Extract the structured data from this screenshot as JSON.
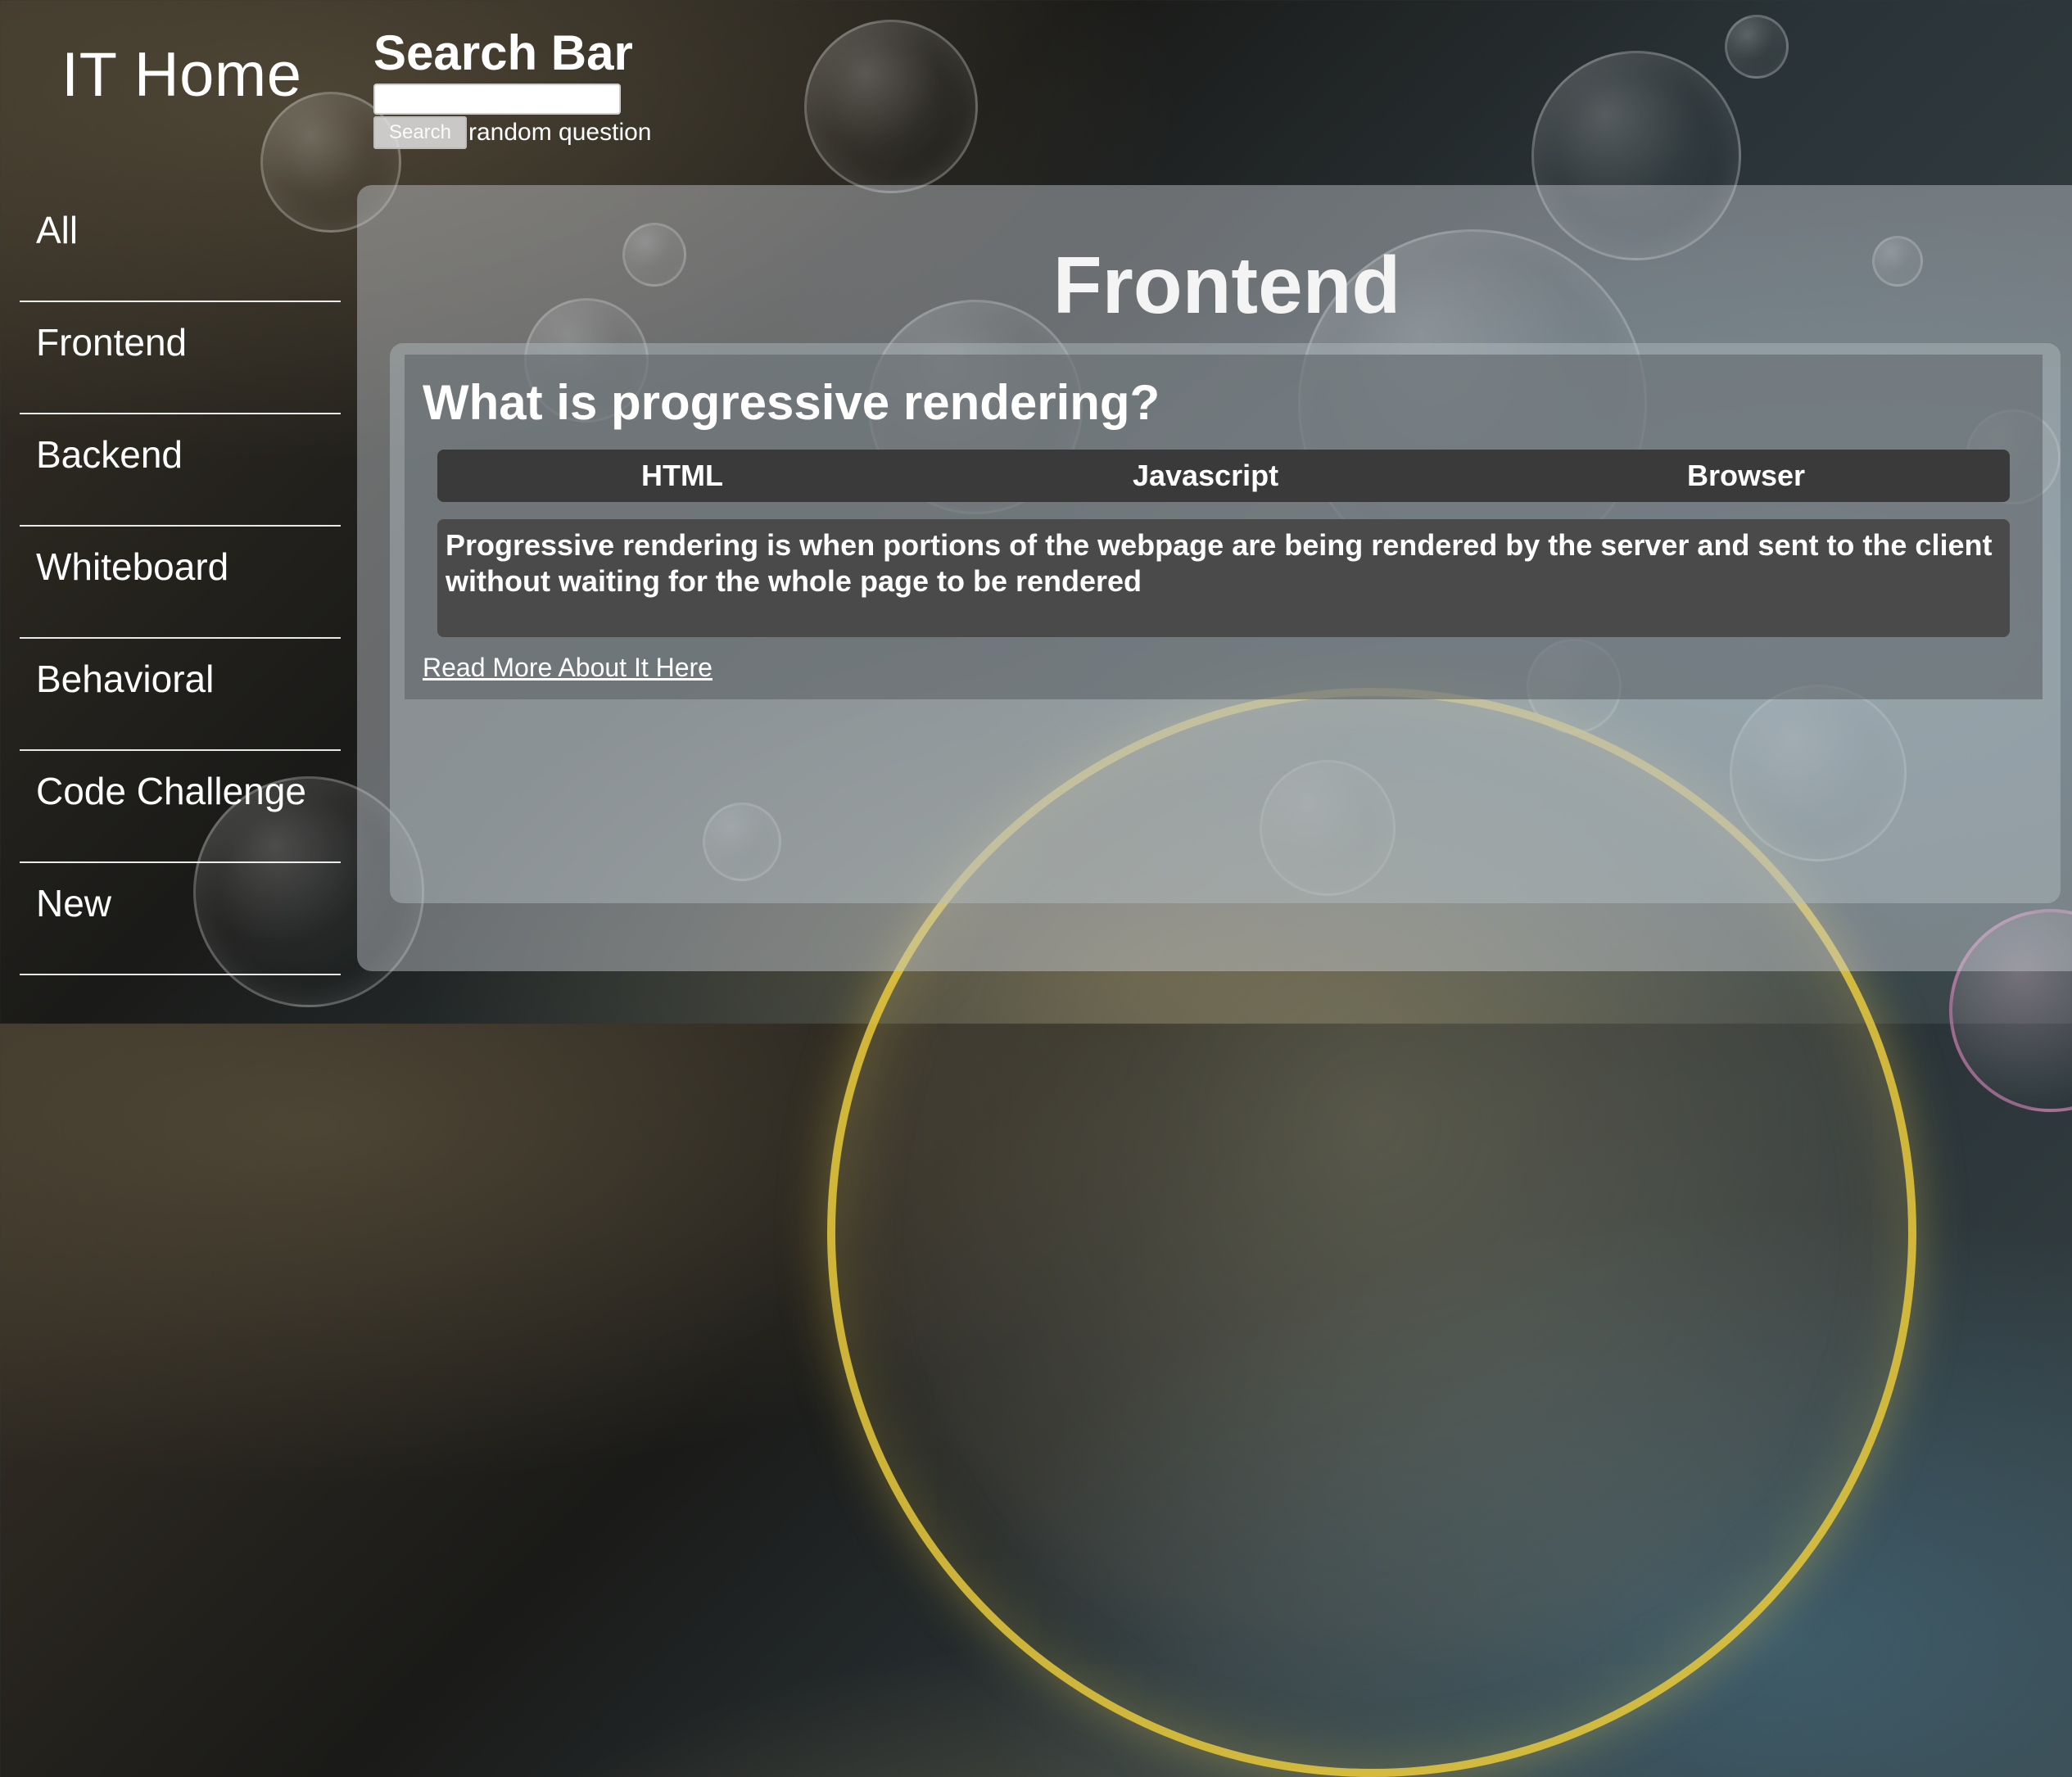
{
  "app": {
    "title": "IT Home"
  },
  "sidebar": {
    "items": [
      {
        "label": "All"
      },
      {
        "label": "Frontend"
      },
      {
        "label": "Backend"
      },
      {
        "label": "Whiteboard"
      },
      {
        "label": "Behavioral"
      },
      {
        "label": "Code Challenge"
      },
      {
        "label": "New"
      }
    ]
  },
  "search": {
    "title": "Search Bar",
    "input_value": "",
    "placeholder": "",
    "button_label": "Search",
    "random_label": "random question"
  },
  "main": {
    "category": "Frontend",
    "question": {
      "title": "What is progressive rendering?",
      "tags": [
        "HTML",
        "Javascript",
        "Browser"
      ],
      "answer": "Progressive rendering is when portions of the webpage are being rendered by the server and sent to the client without waiting for the whole page to be rendered",
      "read_more_label": "Read More About It Here"
    }
  },
  "colors": {
    "panel": "#c8cdd2",
    "tags_bar": "#3a3a3a",
    "answer_box": "#4a4a4a",
    "bubble_accent": "#ebcd3c"
  }
}
